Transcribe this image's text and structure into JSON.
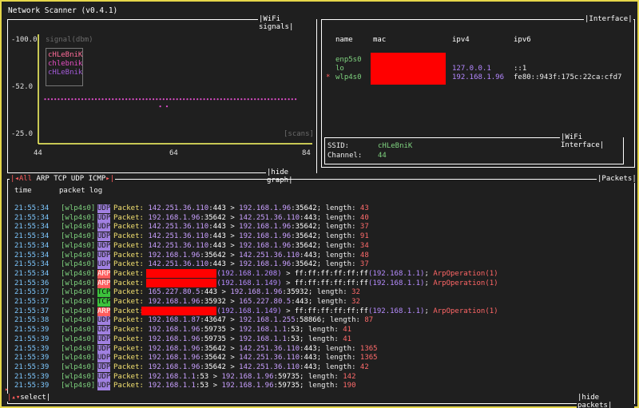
{
  "app": {
    "title": "Network Scanner (v0.4.1)"
  },
  "wifi_signals": {
    "title": "WiFi signals",
    "footer": "hide graph",
    "y_ticks": [
      "-100.0",
      "-52.0",
      "-25.0"
    ],
    "y_axis_label": "signal(dbm)",
    "x_ticks": [
      "44",
      "64",
      "84"
    ],
    "x_axis_label": "[scans]",
    "legend": [
      {
        "name": "cHLeBniK",
        "color": "#ff6b9a"
      },
      {
        "name": "chlebnik",
        "color": "#e64fc4"
      },
      {
        "name": "cHLeBnik",
        "color": "#a35bd9"
      }
    ]
  },
  "chart_data": {
    "type": "scatter",
    "title": "WiFi signals",
    "ylabel": "signal(dbm)",
    "xlabel": "[scans]",
    "x_ticks": [
      44,
      64,
      84
    ],
    "y_ticks": [
      -100,
      -52,
      -25
    ],
    "series": [
      {
        "name": "cHLeBniK",
        "color": "#e54fd0",
        "x_start": 45,
        "x_end": 82,
        "value": -56
      },
      {
        "name": "chlebnik",
        "color": "#e54fd0",
        "x_points": [
          62,
          63
        ],
        "value": -51
      }
    ]
  },
  "interface": {
    "title": "Interface",
    "headers": [
      "name",
      "mac",
      "ipv4",
      "ipv6"
    ],
    "rows": [
      {
        "marker": "",
        "name": "enp5s0",
        "ipv4": "",
        "ipv6": ""
      },
      {
        "marker": "",
        "name": "lo",
        "ipv4": "127.0.0.1",
        "ipv6": "::1"
      },
      {
        "marker": "*",
        "name": "wlp4s0",
        "ipv4": "192.168.1.96",
        "ipv6": "fe80::943f:175c:22ca:cfd7"
      }
    ],
    "wifi_interface": {
      "title": "WiFi Interface",
      "ssid_label": "SSID:",
      "ssid_value": "cHLeBniK",
      "channel_label": "Channel:",
      "channel_value": "44"
    }
  },
  "packets": {
    "title": "Packets",
    "filter_tabs": [
      "All",
      "ARP",
      "TCP",
      "UDP",
      "ICMP"
    ],
    "headers": [
      "time",
      "packet log"
    ],
    "footer_left": "select",
    "footer_right": "hide packets",
    "rows": [
      {
        "time": "21:55:34",
        "iface": "[wlp4s0]",
        "proto": "UDP",
        "src": "142.251.36.110",
        "sport": "443",
        "dst": "192.168.1.96",
        "dport": "35642",
        "length": "43"
      },
      {
        "time": "21:55:34",
        "iface": "[wlp4s0]",
        "proto": "UDP",
        "src": "192.168.1.96",
        "sport": "35642",
        "dst": "142.251.36.110",
        "dport": "443",
        "length": "40"
      },
      {
        "time": "21:55:34",
        "iface": "[wlp4s0]",
        "proto": "UDP",
        "src": "142.251.36.110",
        "sport": "443",
        "dst": "192.168.1.96",
        "dport": "35642",
        "length": "37"
      },
      {
        "time": "21:55:34",
        "iface": "[wlp4s0]",
        "proto": "UDP",
        "src": "142.251.36.110",
        "sport": "443",
        "dst": "192.168.1.96",
        "dport": "35642",
        "length": "91"
      },
      {
        "time": "21:55:34",
        "iface": "[wlp4s0]",
        "proto": "UDP",
        "src": "142.251.36.110",
        "sport": "443",
        "dst": "192.168.1.96",
        "dport": "35642",
        "length": "34"
      },
      {
        "time": "21:55:34",
        "iface": "[wlp4s0]",
        "proto": "UDP",
        "src": "192.168.1.96",
        "sport": "35642",
        "dst": "142.251.36.110",
        "dport": "443",
        "length": "48"
      },
      {
        "time": "21:55:34",
        "iface": "[wlp4s0]",
        "proto": "UDP",
        "src": "142.251.36.110",
        "sport": "443",
        "dst": "192.168.1.96",
        "dport": "35642",
        "length": "37"
      },
      {
        "time": "21:55:34",
        "iface": "[wlp4s0]",
        "proto": "ARP",
        "arp_ip": "(192.168.1.208)",
        "arp_mac": "ff:ff:ff:ff:ff:ff",
        "arp_ip2": "(192.168.1.1)",
        "arp_op": "ArpOperation(1)"
      },
      {
        "time": "21:55:36",
        "iface": "[wlp4s0]",
        "proto": "ARP",
        "arp_ip": "(192.168.1.149)",
        "arp_mac": "ff:ff:ff:ff:ff:ff",
        "arp_ip2": "(192.168.1.1)",
        "arp_op": "ArpOperation(1)"
      },
      {
        "time": "21:55:37",
        "iface": "[wlp4s0]",
        "proto": "TCP",
        "src": "165.227.80.5",
        "sport": "443",
        "dst": "192.168.1.96",
        "dport": "35932",
        "length": "32"
      },
      {
        "time": "21:55:37",
        "iface": "[wlp4s0]",
        "proto": "TCP",
        "src": "192.168.1.96",
        "sport": "35932",
        "dst": "165.227.80.5",
        "dport": "443",
        "length": "32"
      },
      {
        "time": "21:55:37",
        "iface": "[wlp4s0]",
        "proto": "ARP",
        "arp_ip": "(192.168.1.149)",
        "arp_mac": "ff:ff:ff:ff:ff:ff",
        "arp_ip2": "(192.168.1.1)",
        "arp_op": "ArpOperation(1)"
      },
      {
        "time": "21:55:38",
        "iface": "[wlp4s0]",
        "proto": "UDP",
        "src": "192.168.1.87",
        "sport": "43647",
        "dst": "192.168.1.255",
        "dport": "58866",
        "length": "87"
      },
      {
        "time": "21:55:39",
        "iface": "[wlp4s0]",
        "proto": "UDP",
        "src": "192.168.1.96",
        "sport": "59735",
        "dst": "192.168.1.1",
        "dport": "53",
        "length": "41"
      },
      {
        "time": "21:55:39",
        "iface": "[wlp4s0]",
        "proto": "UDP",
        "src": "192.168.1.96",
        "sport": "59735",
        "dst": "192.168.1.1",
        "dport": "53",
        "length": "41"
      },
      {
        "time": "21:55:39",
        "iface": "[wlp4s0]",
        "proto": "UDP",
        "src": "192.168.1.96",
        "sport": "35642",
        "dst": "142.251.36.110",
        "dport": "443",
        "length": "1365"
      },
      {
        "time": "21:55:39",
        "iface": "[wlp4s0]",
        "proto": "UDP",
        "src": "192.168.1.96",
        "sport": "35642",
        "dst": "142.251.36.110",
        "dport": "443",
        "length": "1365"
      },
      {
        "time": "21:55:39",
        "iface": "[wlp4s0]",
        "proto": "UDP",
        "src": "192.168.1.96",
        "sport": "35642",
        "dst": "142.251.36.110",
        "dport": "443",
        "length": "42"
      },
      {
        "time": "21:55:39",
        "iface": "[wlp4s0]",
        "proto": "UDP",
        "src": "192.168.1.1",
        "sport": "53",
        "dst": "192.168.1.96",
        "dport": "59735",
        "length": "142"
      },
      {
        "time": "21:55:39",
        "iface": "[wlp4s0]",
        "proto": "UDP",
        "src": "192.168.1.1",
        "sport": "53",
        "dst": "192.168.1.96",
        "dport": "59735",
        "length": "190"
      }
    ]
  },
  "labels": {
    "packet": "Packet:",
    "length": "length:",
    "arrow": ">"
  }
}
